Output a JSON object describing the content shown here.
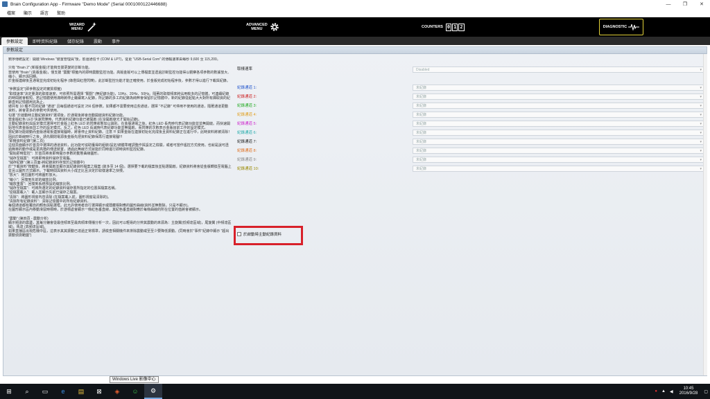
{
  "window": {
    "title": "Brain Configuration App - Firmware \"Demo Mode\" (Serial 0001000122446688)",
    "minimize": "—",
    "maximize": "❐",
    "close": "✕"
  },
  "menu": [
    "檔案",
    "顯示",
    "語言",
    "幫助"
  ],
  "toolbar": {
    "wizard_line1": "WIZARD",
    "wizard_line2": "MENU",
    "advanced_line1": "ADVANCED",
    "advanced_line2": "MENU",
    "counters": "COUNTERS",
    "counter_digits": [
      "0",
      "1",
      "2"
    ],
    "diagnostic": "DIAGNOSTIC"
  },
  "tabs": [
    "參數設定",
    "即時資料紀錄",
    "儲存紀錄",
    "震動",
    "事件"
  ],
  "panel": {
    "header": "參數設定",
    "description": "數序傳統設定：開啟 Windows \"裝置管理員\"後，影還通信卡 (COM & LPT)，從更 \"USB-Serial Com\" 的傳輸速率由每秒 9,600 至 115,200。\n\n只有 \"Brain 2\" (新版金版)才能夠支援更變的診斷功能。\n當使用 \"Brain\" (高版金版)，僅支援 \"震動\"標籤內的即時震動監控功能。高版金版可以上傳檔案並透過診斷監控功能得以觀察各項參數的數據放大、縮小、顯示與回饋。\n於金版連線後且通電並完成初始化程序 (綠燈與紅燈閃爍)，此診斷監控功能才能正確使用。於金版完成初始程序後，參數才得以進行下載與紀錄。\n\n\"參數設定\"(即參數設定的實質標籤)\n\"取樣速率\"決定量測的取樣速度，可依照所需選擇 \"關閉\" (無紀錄功能)，10Hz、20Hz、50Hz。隨著的取樣頻率將佔用較多的記憶體，可連續紀錄的時間將會較短。若記憶體使用滿時將停止繼續寫入紀錄，所記錄的多工的紀錄為純粹會保留於記憶體中，新的紀錄從起點大大對所有擷取資的紀錄直到記憶體用完為止。\n總共有 10 種不同的紀錄 \"通道\" 且每個通道可設定 256 個參數。如果都不需要使用這些通道，選擇 \"不記錄\" 可停用不使用的通道，隨著通道更動資料，將會更多的參數可供使用。\n勾選 \"於啟動時主動紀錄資料\"選項後，於通電後將會自動開啟資料紀錄功能。\n當金版紅色 LED 快速閃爍時，代表資料紀錄功能已被開啟 (在沒開啟綠光才開始記錄)。\n主動紀錄資料與設定模式選擇可於金版上紅色 LED 的閃爍狀態加以識別。在金版通電之後，紅色 LED 長亮時代表記錄功能並並無開啟。而快速開始地代表金版目前工作的設定模式。反之，紅色 LED 長滅時代表紀錄功能並無開啟，而閃爍的次數表示金版目前工作的設定模式。\n當紀錄功能啟動而金版通電後連接電腦時，將會停止資料紀錄。注意 !!! 如果金版在連接初始化完成後且資料紀錄正在進行中，此時資料將被清除！因此於斷線時行之後，請先關閉電源後金版先把資料紀錄保再行連接電腦!!!\n\"即時資料紀錄\"(第二頁)\n這個頁面顯示於首頁中選擇的通道資料，此功能可協助獲得的組裝/設定/總體準確調整作與設定之檢驗，或者可當作遙控方式使用。也就是說可透過簡單的動作或是更高階的傳送裝置，通過此無線方式就能於同時進行即時資料監控紀錄。\n\"開始即時監控\"：於首頁將會即時開示參數的動態曲線圖形。\n\"儲存至檔案\"：可將即時資料儲存至電腦。\n\"儲存紀錄\" (第三頁面-將紀錄資料存放於記憶體中)\n於\"下載資料\"按鍵後，將會開啟並顯示其紀錄資料檔案之檔案 (故多至 14 個)。選擇要下載的檔案後並點選開啟，紀錄資料將會從金版轉換至電腦上並且以圖形方式顯示。下載時間與資料大小成正比且決定於取樣速率之快慢。\n\"放大\"：拖拉圖形可將圖形放大。\n\"縮小\"：回復到先前的縮放比例。\n\"縮放重置\"：回復到系統預設的縮放比例。\n\"儲存至檔案\"：可將所選定的紀錄資料儲存置所指定的位置與檔案名稱。\n\"從檔案載入\"：載入並顯示先前已儲存之檔案。\n\"清除\"：將圖形視窗內容清除 (在檔案載入前，圖形視窗是清除的)。\n\"清除所有紀錄資料\"：清除記憶體中的所有紀錄資料。\n每個通道都有獨自的顏色與點選框。此允許使用者自行選擇顯示或隱藏相對應的圖形曲線(資料並無刪除，只是不顯示)。\n在圖形顯示區內移動滑鼠時標時，於游標處會顯示一條紅色垂直線，其紀色垂直線對應於每條曲線的所在位置的值將會被顯示。\n\n\"震動\" (第四頁 - 震動分析)\n顯示頻道的震盪，其每分鐘會從最佳傾率至最高傾率傳播分析一次，因此可以輕易的分辨其震動的來源為：主旋翼(低頻達區域)，尾旋翼 (中頻達區域)，馬達 (高頻達區域)。\n如果直播區出現危機中區，這表示其其振動已達過正常標準，請檢查相關機件來排除震動或至至少要降低振動。(同時會於\"事件\"紀錄中顯示 \"超出振動偵測範圍\")"
  },
  "settings": {
    "sample_rate_label": "取樣速率",
    "sample_rate_value": "Disabled",
    "channels": [
      {
        "label": "紀錄通道 1:",
        "color": "#2255cc",
        "value": "未紀錄"
      },
      {
        "label": "紀錄通道 2:",
        "color": "#cc2222",
        "value": "未紀錄"
      },
      {
        "label": "紀錄通道 3:",
        "color": "#22aa22",
        "value": "未紀錄"
      },
      {
        "label": "紀錄通道 4:",
        "color": "#e0a020",
        "value": "未紀錄"
      },
      {
        "label": "紀錄通道 5:",
        "color": "#cc22cc",
        "value": "未紀錄"
      },
      {
        "label": "紀錄通道 6:",
        "color": "#22aaaa",
        "value": "未紀錄"
      },
      {
        "label": "紀錄通道 7:",
        "color": "#222222",
        "value": "未紀錄"
      },
      {
        "label": "紀錄通道 8:",
        "color": "#e07020",
        "value": "未紀錄"
      },
      {
        "label": "紀錄通道 9:",
        "color": "#888888",
        "value": "未紀錄"
      },
      {
        "label": "紀錄通道 10:",
        "color": "#998800",
        "value": "未紀錄"
      }
    ],
    "auto_record_label": "於啟動時主動紀錄資料"
  },
  "tooltip": "Windows Live 影像中心",
  "taskbar": {
    "items": [
      "⊞",
      "⌕",
      "▭",
      "e",
      "▤",
      "⊠",
      "◈",
      "☺",
      "⚙"
    ],
    "time": "10:45",
    "date": "2016/9/28"
  }
}
